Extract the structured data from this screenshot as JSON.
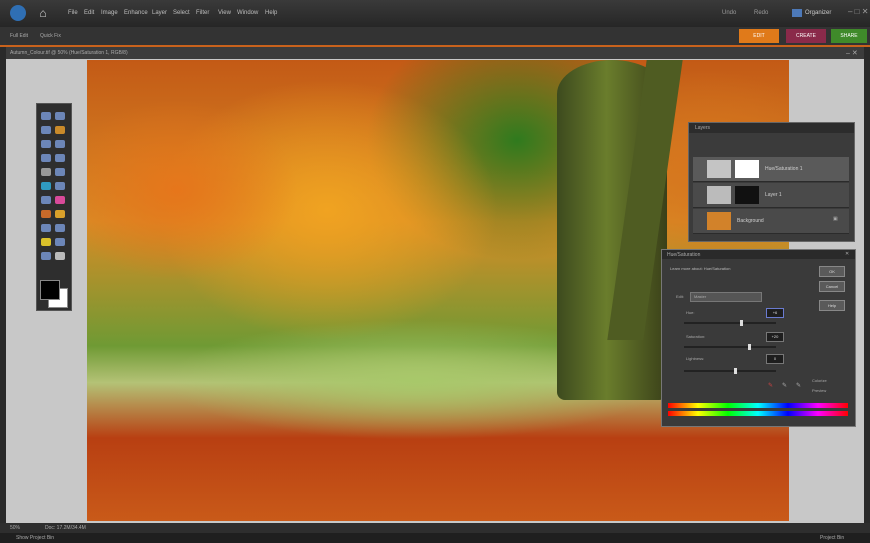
{
  "app": {
    "menu": [
      "File",
      "Edit",
      "Image",
      "Enhance",
      "Layer",
      "Select",
      "Filter",
      "View",
      "Window",
      "Help"
    ],
    "right_items": [
      "Undo",
      "Redo"
    ],
    "organizer_label": "Organizer"
  },
  "subbar": {
    "left_items": [
      "Full Edit",
      "Quick Fix"
    ],
    "mode_buttons": [
      "EDIT",
      "CREATE",
      "SHARE"
    ]
  },
  "colors": {
    "accent_orange": "#c9621c",
    "edit_btn": "#e07a1a",
    "create_btn": "#8a2a4a",
    "share_btn": "#3f8a2a"
  },
  "document": {
    "title": "Autumn_Colour.tif @ 50% (Hue/Saturation 1, RGB/8)"
  },
  "layers_panel": {
    "title": "Layers",
    "rows": [
      {
        "name": "Hue/Saturation 1"
      },
      {
        "name": "Layer 1"
      },
      {
        "name": "Background"
      }
    ]
  },
  "huesat": {
    "title": "Hue/Saturation",
    "learn_more": "Learn more about: Hue/Saturation",
    "edit_label": "Edit:",
    "edit_value": "Master",
    "hue_label": "Hue:",
    "hue_value": "+6",
    "saturation_label": "Saturation:",
    "saturation_value": "+20",
    "lightness_label": "Lightness:",
    "lightness_value": "0",
    "ok": "OK",
    "cancel": "Cancel",
    "help": "Help",
    "colorize": "Colorize",
    "preview": "Preview"
  },
  "status": {
    "zoom": "50%",
    "doc_info": "Doc: 17.2M/34.4M"
  },
  "bottom": {
    "left": "Show Project Bin",
    "right": "Project Bin"
  }
}
